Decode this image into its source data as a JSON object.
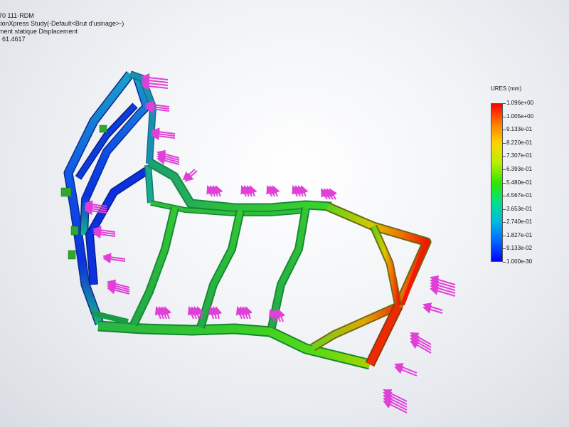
{
  "header": {
    "line1": "70 111-RDM",
    "line2": "tionXpress Study(-Default<Brut d'usinage>-)",
    "line3": "ment statique Displacement",
    "line4": ": 61.4617"
  },
  "legend": {
    "title": "URES (mm)",
    "labels": [
      "1.096e+00",
      "1.005e+00",
      "9.133e-01",
      "8.220e-01",
      "7.307e-01",
      "6.393e-01",
      "5.480e-01",
      "4.567e-01",
      "3.653e-01",
      "2.740e-01",
      "1.827e-01",
      "9.133e-02",
      "1.000e-30"
    ],
    "gradient_colors": [
      "#ff0000",
      "#ff7a00",
      "#ffd400",
      "#b8f000",
      "#33e600",
      "#00e08a",
      "#00b8e0",
      "#0066ff",
      "#0000ff"
    ]
  },
  "model": {
    "colors": {
      "max": "#f02000",
      "high": "#f07800",
      "mid": "#9ad400",
      "green": "#2fc82a",
      "cyan": "#1ab4a0",
      "blue": "#1060e8",
      "deep_blue": "#0a28e0",
      "force_arrow": "#e040d8",
      "fixture": "#2ea82e"
    }
  }
}
